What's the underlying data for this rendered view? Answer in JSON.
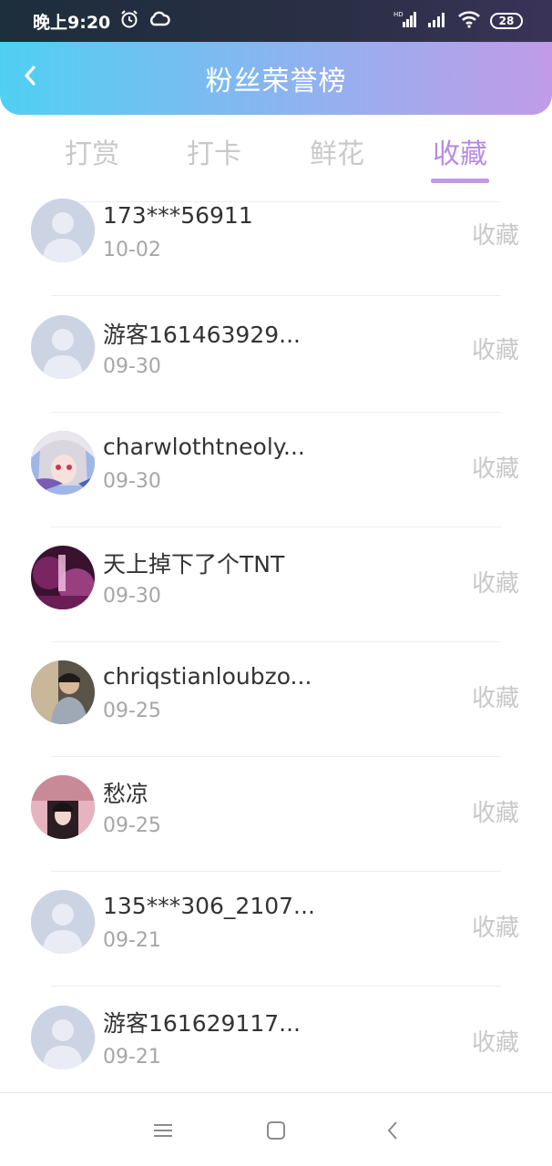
{
  "status_bar": {
    "time": "晚上9:20",
    "alarm_icon": "alarm-icon",
    "cloud_icon": "cloud-icon",
    "network_hd": "HD",
    "battery": "28"
  },
  "header": {
    "title": "粉丝荣誉榜",
    "back_icon": "chevron-left-icon"
  },
  "tabs": [
    {
      "label": "打赏",
      "active": false
    },
    {
      "label": "打卡",
      "active": false
    },
    {
      "label": "鲜花",
      "active": false
    },
    {
      "label": "收藏",
      "active": true
    }
  ],
  "list": [
    {
      "name": "173***56911",
      "date": "10-02",
      "action": "收藏",
      "avatar": "default"
    },
    {
      "name": "游客161463929...",
      "date": "09-30",
      "action": "收藏",
      "avatar": "default"
    },
    {
      "name": "charwlothtneoly...",
      "date": "09-30",
      "action": "收藏",
      "avatar": "anime"
    },
    {
      "name": "天上掉下了个TNT",
      "date": "09-30",
      "action": "收藏",
      "avatar": "photo-pink"
    },
    {
      "name": "chriqstianloubzo...",
      "date": "09-25",
      "action": "收藏",
      "avatar": "photo-man"
    },
    {
      "name": "愁凉",
      "date": "09-25",
      "action": "收藏",
      "avatar": "photo-girl"
    },
    {
      "name": "135***306_2107...",
      "date": "09-21",
      "action": "收藏",
      "avatar": "default"
    },
    {
      "name": "游客161629117...",
      "date": "09-21",
      "action": "收藏",
      "avatar": "default"
    }
  ],
  "nav_bar": {
    "menu_icon": "menu-icon",
    "home_icon": "home-square-icon",
    "back_icon": "back-triangle-icon"
  },
  "colors": {
    "accent": "#b88ae6",
    "header_start": "#4fd0f2",
    "header_end": "#c19be8",
    "muted_text": "#c8c8c8"
  }
}
